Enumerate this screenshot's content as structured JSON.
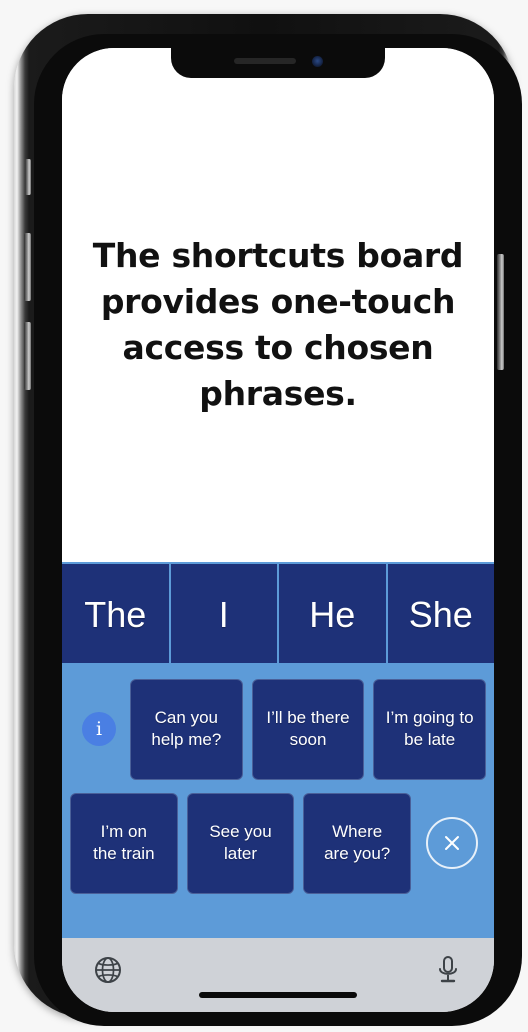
{
  "device": {
    "name": "smartphone-mockup",
    "notch": {
      "speaker": "earpiece-speaker",
      "camera": "front-camera"
    },
    "buttons": [
      "silent-switch",
      "volume-up",
      "volume-down",
      "power-button"
    ],
    "home_indicator": "home-indicator"
  },
  "message_area": {
    "headline": "The shortcuts board provides one-touch access to chosen phrases."
  },
  "word_row": {
    "background_color": "#1e3178",
    "divider_color": "#5d9bd8",
    "words": [
      {
        "label": "The"
      },
      {
        "label": "I"
      },
      {
        "label": "He"
      },
      {
        "label": "She"
      }
    ]
  },
  "shortcuts_board": {
    "background_color": "#5d9bd8",
    "button_color": "#1e3178",
    "info_button": {
      "icon": "info-icon",
      "label": "i",
      "color": "#4a7fe3"
    },
    "close_button": {
      "icon": "close-icon",
      "label": "×"
    },
    "rows": [
      {
        "phrases": [
          {
            "label": "Can you\nhelp me?"
          },
          {
            "label": "I’ll be there\nsoon"
          },
          {
            "label": "I’m going to\nbe late"
          }
        ]
      },
      {
        "phrases": [
          {
            "label": "I’m on\nthe train"
          },
          {
            "label": "See you later"
          },
          {
            "label": "Where\nare you?"
          }
        ]
      }
    ]
  },
  "bottom_toolbar": {
    "background_color": "#cfd2d7",
    "left_icon": {
      "name": "globe-icon",
      "label": "Globe"
    },
    "right_icon": {
      "name": "microphone-icon",
      "label": "Microphone"
    }
  }
}
